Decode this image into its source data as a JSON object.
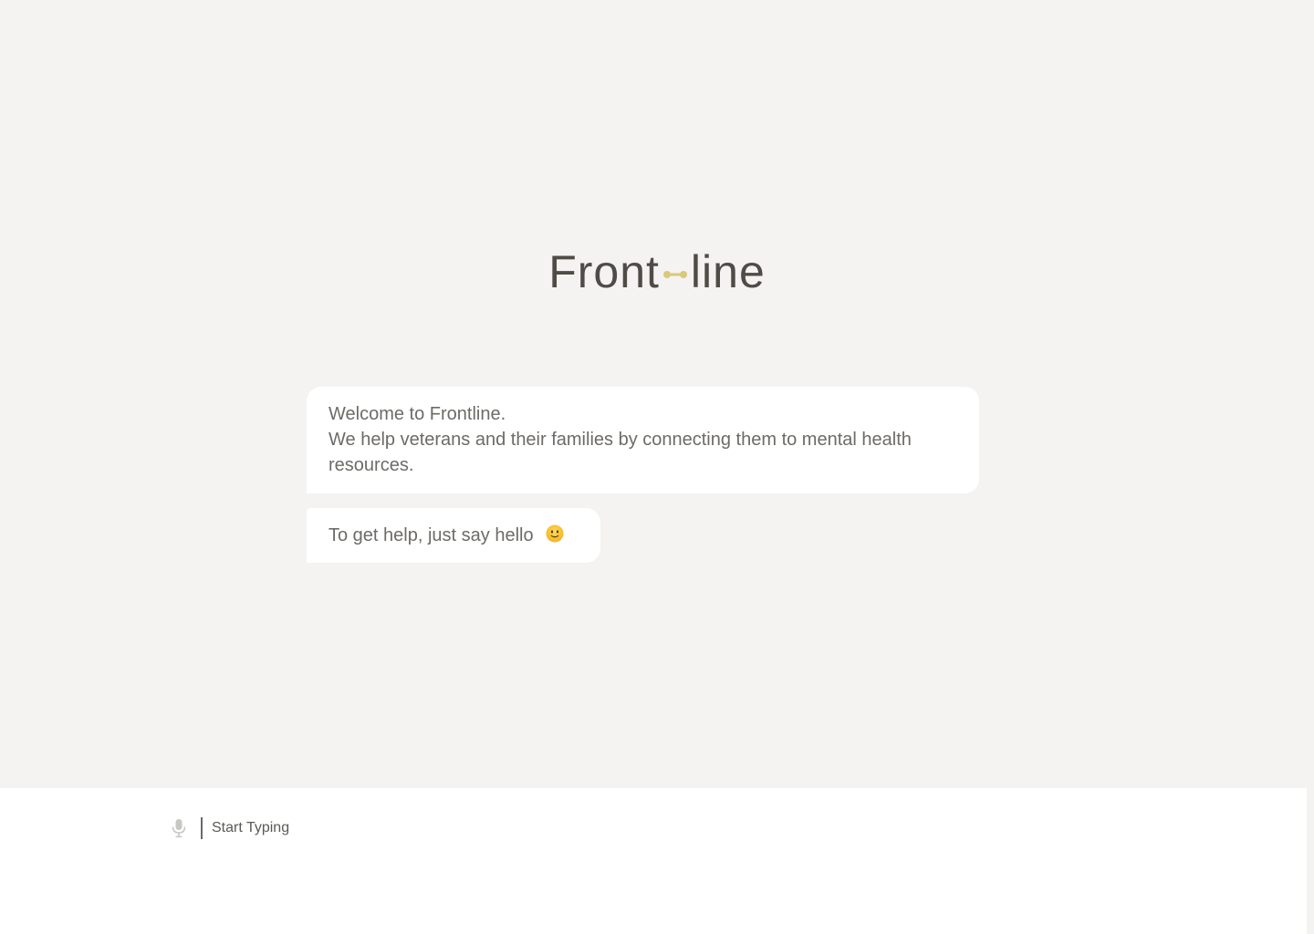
{
  "app": {
    "logo_left": "Front",
    "logo_right": "line"
  },
  "colors": {
    "background": "#f4f3f1",
    "bubble": "#ffffff",
    "text": "#6d6b67",
    "logo_text": "#4f4c47",
    "accent": "#d9c97a"
  },
  "chat": {
    "messages": [
      {
        "lines": [
          "Welcome to Frontline.",
          "We help veterans and their families by connecting them to mental health resources."
        ]
      },
      {
        "text": "To get help, just say hello",
        "emoji": "slightly-smiling-face-icon"
      }
    ]
  },
  "input": {
    "placeholder": "Start Typing",
    "value": "",
    "mic_icon": "microphone-icon"
  }
}
